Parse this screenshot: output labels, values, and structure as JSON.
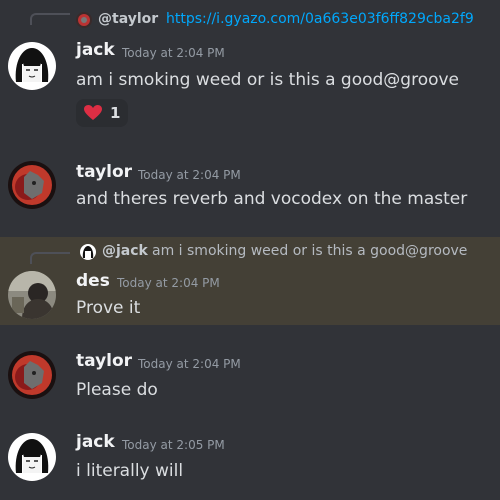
{
  "messages": [
    {
      "reply": {
        "author": "@taylor",
        "text": "https://i.gyazo.com/0a663e03f6ff829cba2f9"
      },
      "author": "jack",
      "timestamp": "Today at 2:04 PM",
      "content": "am i smoking weed or is this a good@groove",
      "reaction": {
        "emoji": "heart",
        "count": "1"
      }
    },
    {
      "author": "taylor",
      "timestamp": "Today at 2:04 PM",
      "content": "and theres reverb and vocodex on the master"
    },
    {
      "reply": {
        "author": "@jack",
        "text": "am i smoking weed or is this a good@groove"
      },
      "author": "des",
      "timestamp": "Today at 2:04 PM",
      "content": "Prove it"
    },
    {
      "author": "taylor",
      "timestamp": "Today at 2:04 PM",
      "content": "Please do"
    },
    {
      "author": "jack",
      "timestamp": "Today at 2:05 PM",
      "content": "i literally will"
    }
  ],
  "colors": {
    "background": "#313338",
    "highlight": "#444036",
    "link": "#00a8fc",
    "heart": "#dd2e44"
  }
}
